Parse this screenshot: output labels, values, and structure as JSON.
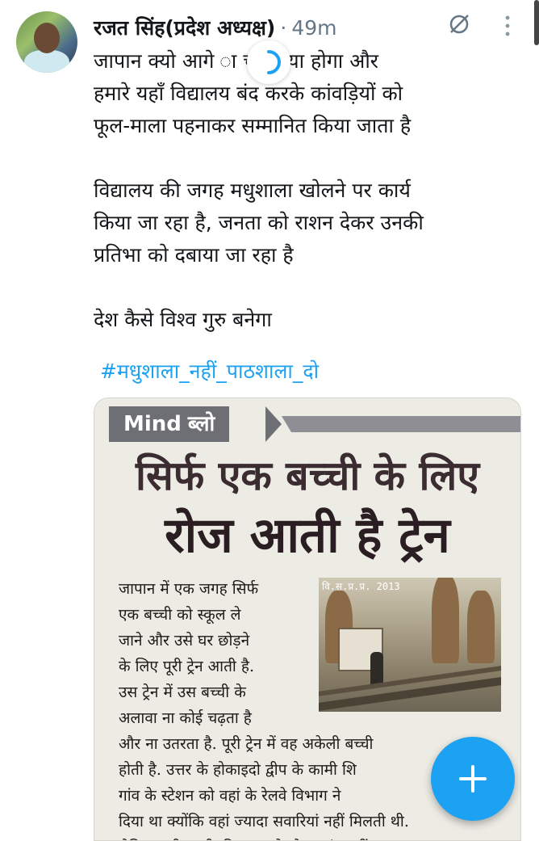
{
  "tweet": {
    "author_name": "रजत सिंह(प्रदेश अध्यक्ष)",
    "separator": "·",
    "time": "49m",
    "paragraphs": [
      "जापान क्यो आगे  ा चल गया होगा और\nहमारे यहाँ विद्यालय बंद करके कांवड़ियों को\nफूल-माला पहनाकर सम्मानित किया जाता है",
      "विद्यालय की जगह मधुशाला खोलने पर कार्य\nकिया जा रहा है, जनता को राशन देकर उनकी\nप्रतिभा को दबाया जा रहा है",
      "देश कैसे विश्व गुरु बनेगा"
    ],
    "hashtag": "#मधुशाला_नहीं_पाठशाला_दो"
  },
  "media": {
    "banner_brand": "Mind",
    "banner_suffix": "ब्लो",
    "headline_line1": "सिर्फ एक बच्ची के लिए",
    "headline_line2": "रोज आती है ट्रेन",
    "photo_caption": "वि.स.प्र.प्र. 2013",
    "article_left_lines": [
      "जापान में एक जगह सिर्फ",
      "एक बच्ची को स्कूल ले",
      "जाने और उसे घर छोड़ने",
      "के लिए पूरी ट्रेन आती है.",
      "उस ट्रेन में उस बच्ची के",
      "अलावा ना कोई चढ़ता है"
    ],
    "article_full_lines": [
      "और ना उतरता है. पूरी ट्रेन में वह अकेली बच्ची",
      "होती है. उत्तर के होकाइदो द्वीप के कामी शि",
      "गांव के स्टेशन को वहां के रेलवे विभाग ने",
      "दिया था क्योंकि वहां ज्यादा सवारियां नहीं मिलती थी.",
      "लेकिन उसी बच्ची की वजह से स्टेशन बंद नहीं"
    ]
  },
  "icons": {
    "dnd": "do-not-disturb-icon",
    "more": "more-vertical-icon",
    "loading": "loading-spinner-icon",
    "compose": "plus-icon"
  },
  "colors": {
    "accent": "#1da1f2",
    "text": "#14171a",
    "secondary": "#657786"
  }
}
